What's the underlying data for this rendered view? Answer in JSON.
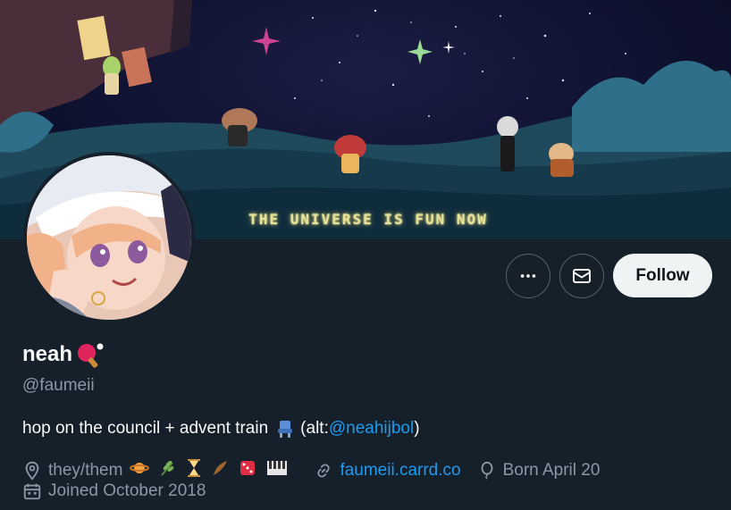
{
  "banner": {
    "text": "THE UNIVERSE IS FUN NOW"
  },
  "actions": {
    "more_label": "More",
    "message_label": "Message",
    "follow_label": "Follow"
  },
  "profile": {
    "display_name": "neah",
    "name_emoji": "ping-pong-paddle-emoji",
    "handle": "@faumeii",
    "bio_text": "hop on the council + advent train",
    "bio_alt_prefix": "(alt: ",
    "bio_alt_handle": "@neahijbol",
    "bio_alt_suffix": ")",
    "pronouns": "they/them",
    "website": "faumeii.carrd.co",
    "birthday": "Born April 20",
    "joined": "Joined October 2018"
  },
  "colors": {
    "background": "#15202b",
    "text_primary": "#f7f9f9",
    "text_secondary": "#8b98a5",
    "link": "#1d9bf0",
    "follow_bg": "#eff3f4"
  },
  "icons": {
    "location": "location-pin-icon",
    "link": "link-icon",
    "birthday": "balloon-icon",
    "joined": "calendar-icon",
    "more": "ellipsis-icon",
    "message": "envelope-icon",
    "bio_emoji": "seat-emoji",
    "pronoun_emojis": [
      "planet-emoji",
      "herb-emoji",
      "hourglass-emoji",
      "feather-emoji",
      "dice-emoji",
      "piano-emoji"
    ]
  }
}
